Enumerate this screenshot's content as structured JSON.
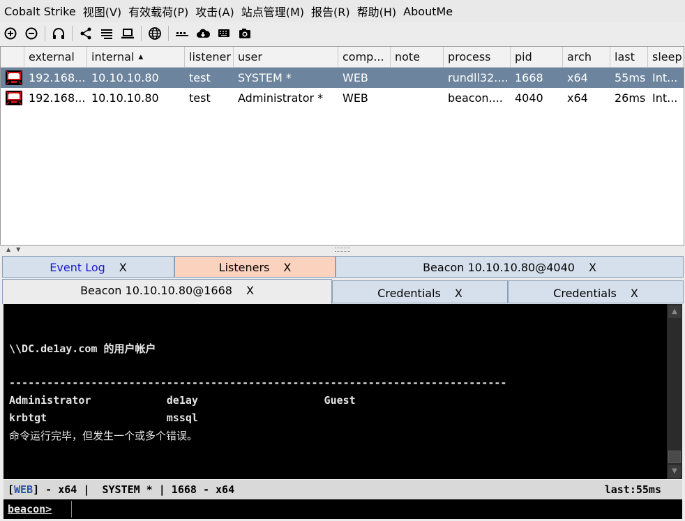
{
  "menu": [
    "Cobalt Strike",
    "视图(V)",
    "有效载荷(P)",
    "攻击(A)",
    "站点管理(M)",
    "报告(R)",
    "帮助(H)",
    "AboutMe"
  ],
  "toolbar_icons": [
    "plus-circle-icon",
    "minus-circle-icon",
    "headphones-icon",
    "share-icon",
    "list-icon",
    "laptop-icon",
    "globe-icon",
    "keys-icon",
    "cloud-download-icon",
    "keyboard-icon",
    "camera-icon"
  ],
  "sessions": {
    "columns": [
      "",
      "external",
      "internal",
      "listener",
      "user",
      "comp...",
      "note",
      "process",
      "pid",
      "arch",
      "last",
      "sleep"
    ],
    "sort_column": "internal",
    "rows": [
      {
        "external": "192.168...",
        "internal": "10.10.10.80",
        "listener": "test",
        "user": "SYSTEM *",
        "computer": "WEB",
        "note": "",
        "process": "rundll32....",
        "pid": "1668",
        "arch": "x64",
        "last": "55ms",
        "sleep": "Int..."
      },
      {
        "external": "192.168...",
        "internal": "10.10.10.80",
        "listener": "test",
        "user": "Administrator *",
        "computer": "WEB",
        "note": "",
        "process": "beacon....",
        "pid": "4040",
        "arch": "x64",
        "last": "26ms",
        "sleep": "Int..."
      }
    ]
  },
  "tabs": {
    "close": "X",
    "row1": [
      "Event Log",
      "Listeners",
      "Beacon 10.10.10.80@4040"
    ],
    "row2": [
      "Beacon 10.10.10.80@1668",
      "Credentials",
      "Credentials"
    ]
  },
  "console": {
    "lines": [
      "\\\\DC.de1ay.com 的用户帐户",
      "-------------------------------------------------------------------------------",
      "Administrator            de1ay                    Guest",
      "krbtgt                   mssql",
      "命令运行完毕，但发生一个或多个错误。"
    ]
  },
  "status": {
    "open": "[",
    "tag": "WEB",
    "rest": "] - x64 |  SYSTEM * | 1668 - x64",
    "last": "last:55ms"
  },
  "prompt": "beacon>",
  "colors": {
    "selected_row": "#6c849d",
    "listeners_tab": "#fbd2bd",
    "tab": "#d6e0ec",
    "webtag": "#2a52a6"
  }
}
